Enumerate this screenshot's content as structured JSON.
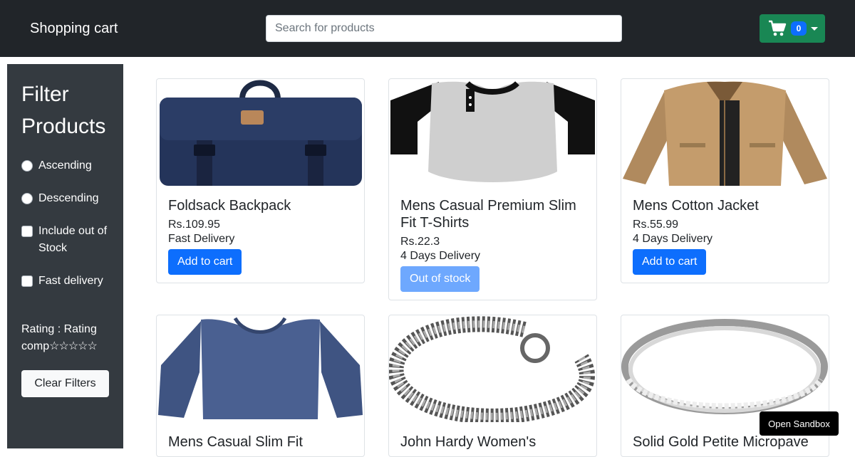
{
  "header": {
    "brand": "Shopping cart",
    "search_placeholder": "Search for products",
    "cart_count": "0"
  },
  "sidebar": {
    "title": "Filter Products",
    "options": {
      "ascending": "Ascending",
      "descending": "Descending",
      "include_out_of_stock": "Include out of Stock",
      "fast_delivery": "Fast delivery"
    },
    "rating_label": "Rating :",
    "rating_alt": "Rating comp",
    "rating_stars": "☆☆☆☆☆",
    "clear_label": "Clear Filters"
  },
  "products": [
    {
      "title": "Foldsack Backpack",
      "price": "Rs.109.95",
      "delivery": "Fast Delivery",
      "button": "Add to cart",
      "image": "backpack"
    },
    {
      "title": "Mens Casual Premium Slim Fit T-Shirts",
      "price": "Rs.22.3",
      "delivery": "4 Days Delivery",
      "button": "Out of stock",
      "image": "t-shirt"
    },
    {
      "title": "Mens Cotton Jacket",
      "price": "Rs.55.99",
      "delivery": "4 Days Delivery",
      "button": "Add to cart",
      "image": "jacket"
    },
    {
      "title": "Mens Casual Slim Fit",
      "image": "long-sleeve-shirt"
    },
    {
      "title": "John Hardy Women's",
      "image": "bracelet"
    },
    {
      "title": "Solid Gold Petite Micropave",
      "image": "ring"
    }
  ],
  "sandbox_label": "Open Sandbox",
  "colors": {
    "navbar": "#212529",
    "sidebar": "#343a40",
    "primary": "#0d6efd",
    "success": "#198754"
  }
}
